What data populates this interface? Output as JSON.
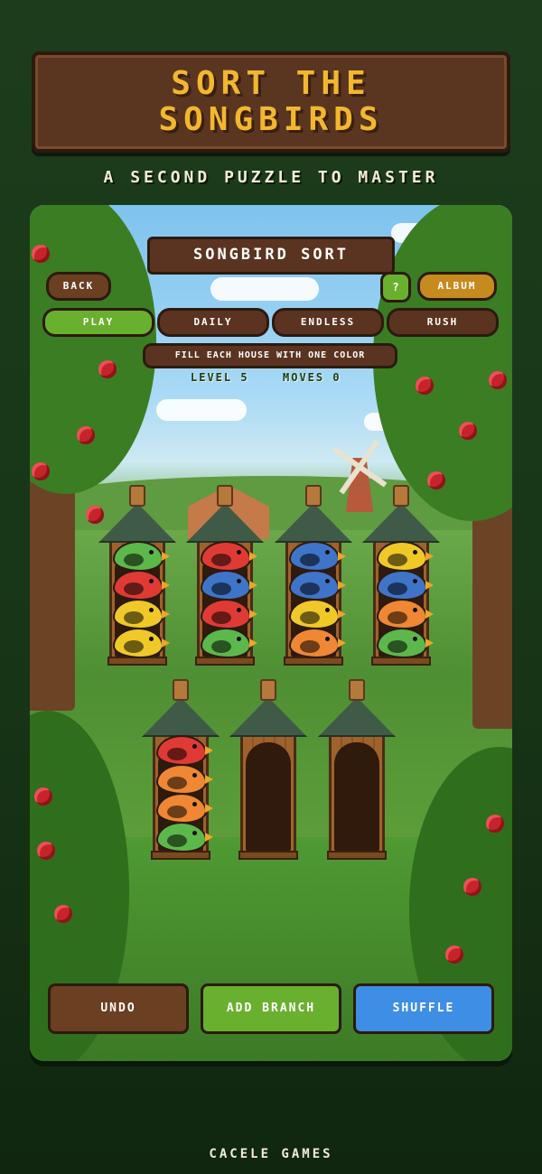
{
  "banner": {
    "title_line1": "SORT THE",
    "title_line2": "SONGBIRDS"
  },
  "subtitle": "A SECOND PUZZLE TO MASTER",
  "game": {
    "header": "SONGBIRD SORT",
    "back_label": "BACK",
    "help_label": "?",
    "album_label": "ALBUM",
    "modes": [
      {
        "label": "PLAY",
        "active": true
      },
      {
        "label": "DAILY",
        "active": false
      },
      {
        "label": "ENDLESS",
        "active": false
      },
      {
        "label": "RUSH",
        "active": false
      }
    ],
    "instruction": "FILL EACH HOUSE WITH ONE COLOR",
    "level_text": "LEVEL 5",
    "moves_text": "MOVES 0",
    "houses": [
      {
        "birds": [
          "yellow",
          "yellow",
          "red",
          "green"
        ]
      },
      {
        "birds": [
          "green",
          "red",
          "blue",
          "red"
        ]
      },
      {
        "birds": [
          "orange",
          "yellow",
          "blue",
          "blue"
        ]
      },
      {
        "birds": [
          "green",
          "orange",
          "blue",
          "yellow"
        ]
      },
      {
        "birds": [
          "green",
          "orange",
          "orange",
          "red"
        ]
      },
      {
        "birds": []
      },
      {
        "birds": []
      }
    ],
    "bird_colors": {
      "red": "#e03a35",
      "blue": "#3f74c9",
      "yellow": "#f0c929",
      "green": "#5cb84a",
      "orange": "#ef8734"
    },
    "undo_label": "UNDO",
    "add_branch_label": "ADD BRANCH",
    "shuffle_label": "SHUFFLE"
  },
  "footer": "CACELE GAMES"
}
